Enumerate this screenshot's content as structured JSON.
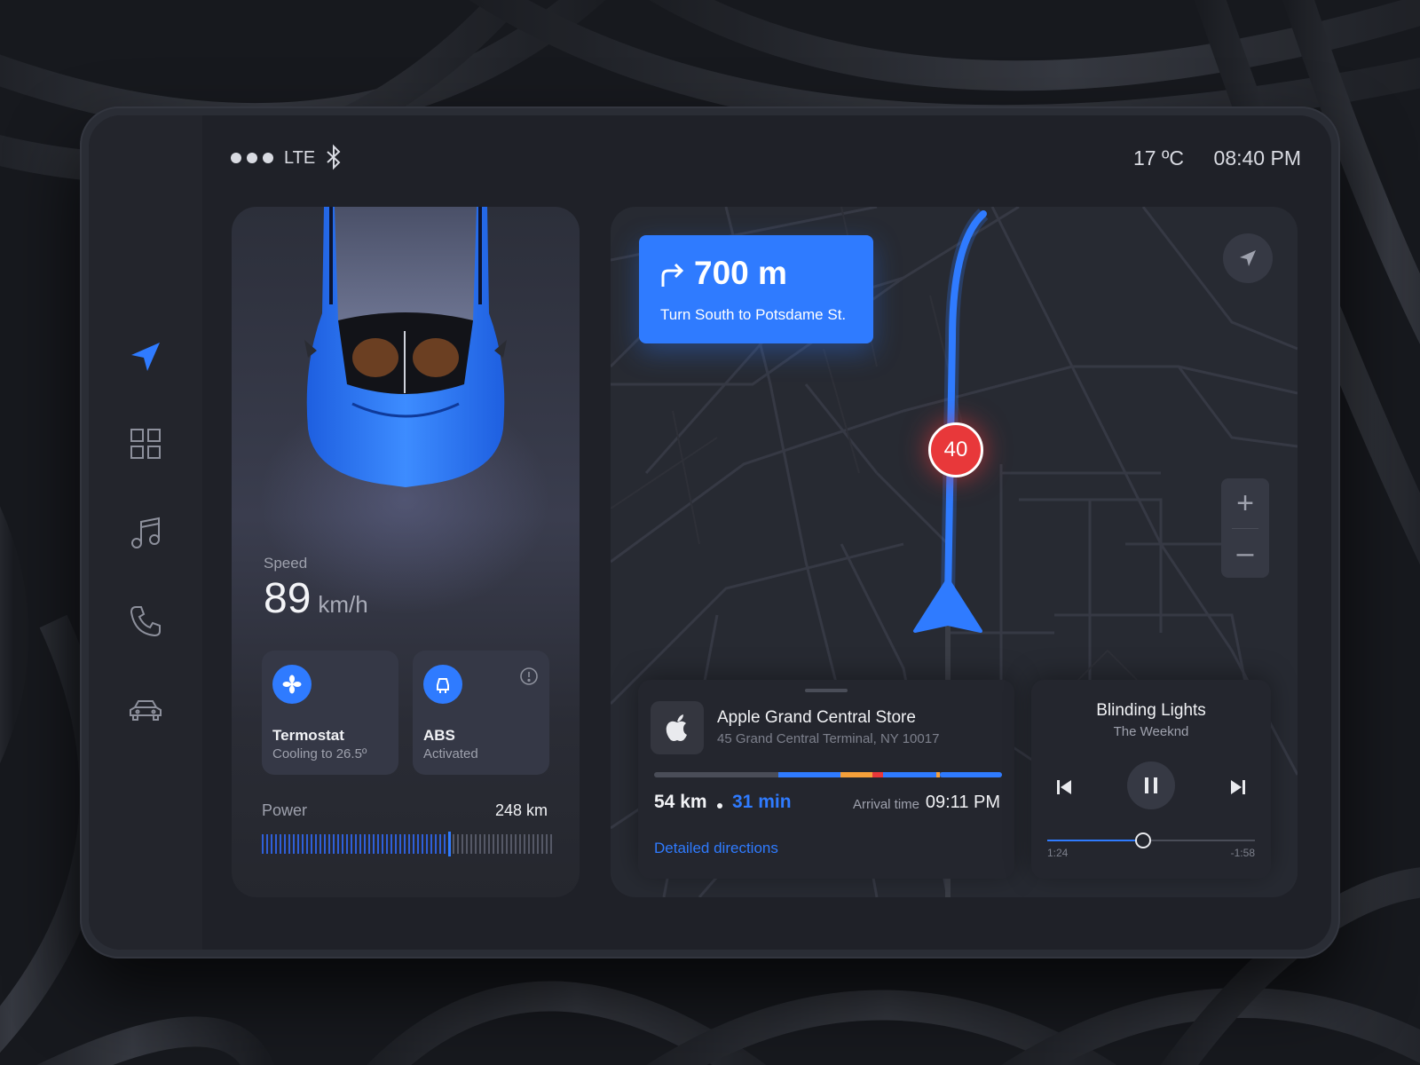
{
  "status": {
    "network": "LTE",
    "temperature": "17 ºC",
    "time": "08:40 PM"
  },
  "sidebar": {
    "items": [
      {
        "name": "navigation",
        "icon": "navigation-arrow-icon",
        "active": true
      },
      {
        "name": "apps",
        "icon": "grid-icon",
        "active": false
      },
      {
        "name": "music",
        "icon": "music-note-icon",
        "active": false
      },
      {
        "name": "phone",
        "icon": "phone-icon",
        "active": false
      },
      {
        "name": "car",
        "icon": "car-icon",
        "active": false
      }
    ]
  },
  "vehicle": {
    "speed_label": "Speed",
    "speed_value": "89",
    "speed_unit": "km/h",
    "tiles": [
      {
        "title": "Termostat",
        "subtitle": "Cooling to 26.5º",
        "icon": "fan-icon"
      },
      {
        "title": "ABS",
        "subtitle": "Activated",
        "icon": "abs-icon",
        "alert": true
      }
    ],
    "power_label": "Power",
    "power_value": "248 km",
    "power_level": 0.65
  },
  "navigation": {
    "turn_distance": "700 m",
    "turn_instruction": "Turn South to Potsdame St.",
    "speed_limit": "40",
    "zoom_in": "+",
    "zoom_out": "–"
  },
  "destination": {
    "name": "Apple Grand Central Store",
    "address": "45 Grand Central Terminal, NY 10017",
    "distance": "54 km",
    "duration": "31 min",
    "arrival_label": "Arrival time",
    "arrival_time": "09:11 PM",
    "link": "Detailed directions"
  },
  "music": {
    "title": "Blinding Lights",
    "artist": "The Weeknd",
    "elapsed": "1:24",
    "remaining": "-1:58",
    "progress": 0.46
  },
  "colors": {
    "accent": "#2f7bff",
    "alert": "#e8383a",
    "traffic_orange": "#f5a03a",
    "background": "#1f2128"
  }
}
